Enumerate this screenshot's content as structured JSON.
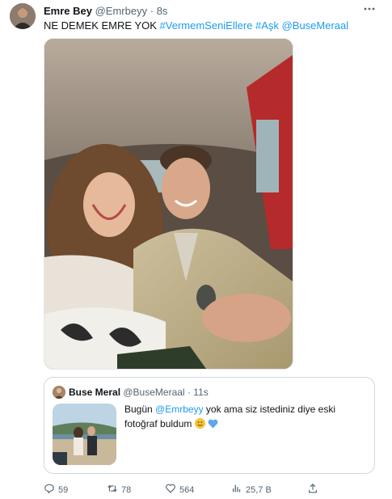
{
  "tweet": {
    "display_name": "Emre Bey",
    "handle": "@Emrbeyy",
    "separator": "·",
    "time": "8s",
    "text_plain": "NE DEMEK EMRE YOK",
    "hashtags": [
      "#VermemSeniEllere",
      "#Aşk"
    ],
    "mention": "@BuseMeraal",
    "more_icon": "more-horizontal-icon"
  },
  "quote": {
    "display_name": "Buse Meral",
    "handle": "@BuseMeraal",
    "separator": "·",
    "time": "11s",
    "text_before": "Bugün",
    "text_mention": "@Emrbeyy",
    "text_after": "yok ama siz istediniz diye eski fotoğraf buldum"
  },
  "actions": {
    "reply_count": "59",
    "retweet_count": "78",
    "like_count": "564",
    "views_count": "25,7 B"
  },
  "colors": {
    "accent": "#1d9bf0",
    "muted": "#536471",
    "border": "#cfd9de"
  }
}
